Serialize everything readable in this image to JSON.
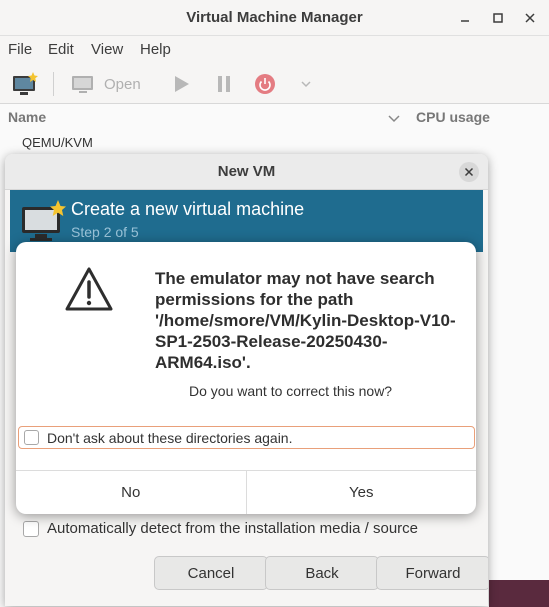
{
  "main_window": {
    "title": "Virtual Machine Manager",
    "menu": [
      "File",
      "Edit",
      "View",
      "Help"
    ],
    "toolbar": {
      "open_label": "Open"
    },
    "list": {
      "name_header": "Name",
      "cpu_header": "CPU usage",
      "connection": "QEMU/KVM"
    }
  },
  "new_vm": {
    "title": "New VM",
    "banner": {
      "heading": "Create a new virtual machine",
      "step": "Step 2 of 5"
    },
    "autodetect_label": "Automatically detect from the installation media / source",
    "buttons": {
      "cancel": "Cancel",
      "back": "Back",
      "forward": "Forward"
    }
  },
  "dialog": {
    "message": "The emulator may not have search permissions for the path '/home/smore/VM/Kylin-Desktop-V10-SP1-2503-Release-20250430-ARM64.iso'.",
    "question": "Do you want to correct this now?",
    "checkbox_label": "Don't ask about these directories again.",
    "no_label": "No",
    "yes_label": "Yes"
  },
  "colors": {
    "banner": "#1f6c8f",
    "power_icon": "#e0565f",
    "focus_outline": "#e9a07a"
  }
}
